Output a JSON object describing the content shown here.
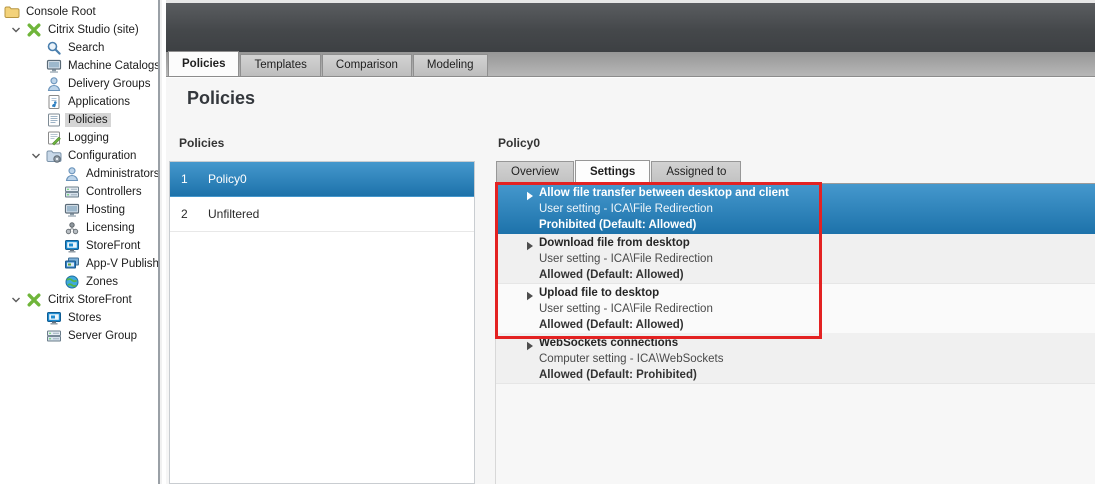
{
  "colors": {
    "selection_top": "#4598cd",
    "selection_bottom": "#1d72aa",
    "annotation_red": "#e32222",
    "citrix_green": "#6fb53a",
    "banner_dark": "#45484b"
  },
  "tree": {
    "items": [
      {
        "label": "Console Root",
        "icon": "folder-icon",
        "level": 0
      },
      {
        "label": "Citrix Studio (site)",
        "icon": "citrix-icon",
        "level": 1,
        "expandable": true
      },
      {
        "label": "Search",
        "icon": "search-icon",
        "level": 2
      },
      {
        "label": "Machine Catalogs",
        "icon": "monitor-icon",
        "level": 2
      },
      {
        "label": "Delivery Groups",
        "icon": "person-icon",
        "level": 2
      },
      {
        "label": "Applications",
        "icon": "applications-icon",
        "level": 2
      },
      {
        "label": "Policies",
        "icon": "policies-icon",
        "level": 2,
        "selected": true
      },
      {
        "label": "Logging",
        "icon": "logging-icon",
        "level": 2
      },
      {
        "label": "Configuration",
        "icon": "config-folder-icon",
        "level": 2,
        "expandable": true
      },
      {
        "label": "Administrators",
        "icon": "person-icon",
        "level": 3
      },
      {
        "label": "Controllers",
        "icon": "server-icon",
        "level": 3
      },
      {
        "label": "Hosting",
        "icon": "monitor-icon",
        "level": 3
      },
      {
        "label": "Licensing",
        "icon": "licensing-icon",
        "level": 3
      },
      {
        "label": "StoreFront",
        "icon": "storefront-icon",
        "level": 3
      },
      {
        "label": "App-V Publishi",
        "icon": "appv-icon",
        "level": 3
      },
      {
        "label": "Zones",
        "icon": "globe-icon",
        "level": 3
      },
      {
        "label": "Citrix StoreFront",
        "icon": "citrix-icon",
        "level": 1,
        "expandable": true
      },
      {
        "label": "Stores",
        "icon": "storefront-icon",
        "level": 2
      },
      {
        "label": "Server Group",
        "icon": "server-icon",
        "level": 2
      }
    ]
  },
  "main": {
    "tabs": [
      {
        "label": "Policies",
        "active": true
      },
      {
        "label": "Templates"
      },
      {
        "label": "Comparison"
      },
      {
        "label": "Modeling"
      }
    ],
    "heading": "Policies",
    "policies_panel": {
      "label": "Policies",
      "rows": [
        {
          "num": "1",
          "name": "Policy0",
          "selected": true
        },
        {
          "num": "2",
          "name": "Unfiltered"
        }
      ]
    },
    "policy_detail": {
      "title": "Policy0",
      "tabs": [
        {
          "label": "Overview"
        },
        {
          "label": "Settings",
          "active": true
        },
        {
          "label": "Assigned to"
        }
      ],
      "settings": [
        {
          "name": "Allow file transfer between desktop and client",
          "detail": "User setting - ICA\\File Redirection",
          "value": "Prohibited (Default: Allowed)",
          "selected": true
        },
        {
          "name": "Download file from desktop",
          "detail": "User setting - ICA\\File Redirection",
          "value": "Allowed (Default: Allowed)"
        },
        {
          "name": "Upload file to desktop",
          "detail": "User setting - ICA\\File Redirection",
          "value": "Allowed (Default: Allowed)"
        },
        {
          "name": "WebSockets connections",
          "detail": "Computer setting - ICA\\WebSockets",
          "value": "Allowed (Default: Prohibited)"
        }
      ]
    }
  }
}
